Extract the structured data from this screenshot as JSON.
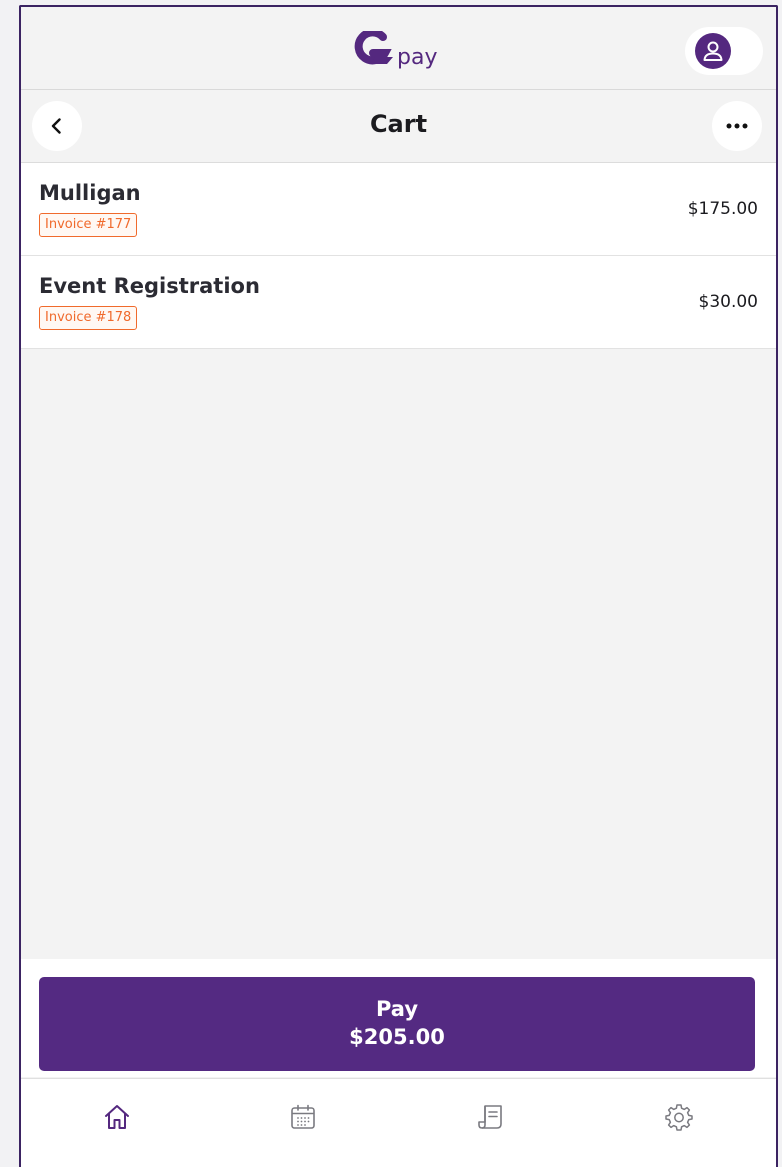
{
  "app": {
    "logo_text": "pay",
    "brand_color": "#54287f",
    "accent_color": "#f06a2c"
  },
  "header": {
    "title": "Cart",
    "back_icon": "chevron-left-icon",
    "more_icon": "ellipsis-icon",
    "profile_icon": "user-icon"
  },
  "cart": {
    "items": [
      {
        "name": "Mulligan",
        "invoice": "Invoice #177",
        "price": "$175.00"
      },
      {
        "name": "Event Registration",
        "invoice": "Invoice #178",
        "price": "$30.00"
      }
    ]
  },
  "pay_button": {
    "label": "Pay",
    "amount": "$205.00"
  },
  "bottom_nav": {
    "tabs": [
      {
        "icon": "home-icon",
        "active": true
      },
      {
        "icon": "calendar-icon",
        "active": false
      },
      {
        "icon": "receipt-icon",
        "active": false
      },
      {
        "icon": "gear-icon",
        "active": false
      }
    ]
  }
}
